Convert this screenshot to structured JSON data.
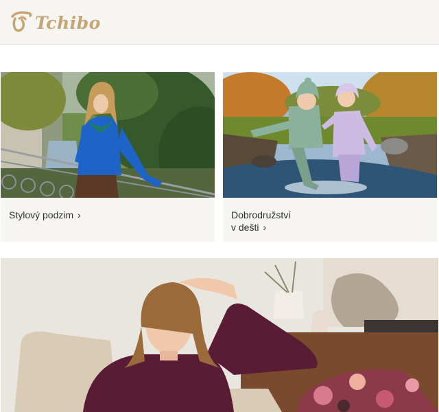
{
  "brand": {
    "name": "Tchibo",
    "color": "#c5a572"
  },
  "cards": [
    {
      "label": "Stylový podzim",
      "chevron": "›"
    },
    {
      "label_line1": "Dobrodružství",
      "label_line2": "v dešti",
      "chevron": "›"
    }
  ],
  "icons": {
    "chevron": "chevron-right-icon",
    "logo": "tchibo-cup-logo-icon"
  },
  "colors": {
    "header_bg": "#f7f5f2",
    "card_bg": "#f7f5f2",
    "text": "#2f2f2f"
  }
}
